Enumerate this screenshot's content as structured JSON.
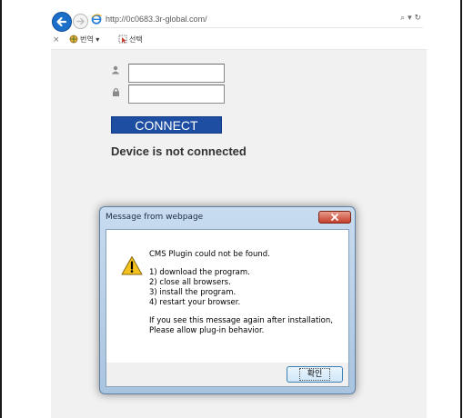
{
  "browser": {
    "url": "http://0c0683.3r-global.com/",
    "address_tools": "⌕ ▾ ↻",
    "close_tab_glyph": "×",
    "toolbar": {
      "translate_label": "번역 ▾",
      "select_label": "선택"
    }
  },
  "login": {
    "username_value": "",
    "password_value": "",
    "connect_label": "CONNECT",
    "status_text": "Device is not connected"
  },
  "dialog": {
    "title": "Message from webpage",
    "close_glyph": "×",
    "lines": [
      "CMS Plugin could not be found.",
      "1) download the program.",
      "2) close all browsers.",
      "3) install the program.",
      "4) restart your browser.",
      "If you see this message again after installation,",
      "Please allow plug-in behavior."
    ],
    "ok_label": "확인"
  },
  "icons": {
    "back": "back-arrow-icon",
    "forward": "forward-arrow-icon",
    "browser": "ie-icon",
    "translate": "translate-icon",
    "select": "select-icon",
    "user": "user-icon",
    "lock": "lock-icon",
    "warning": "warning-icon"
  },
  "colors": {
    "connect_bg": "#1e4ea2",
    "back_button": "#1b6fc8",
    "dialog_close": "#c4402b"
  }
}
